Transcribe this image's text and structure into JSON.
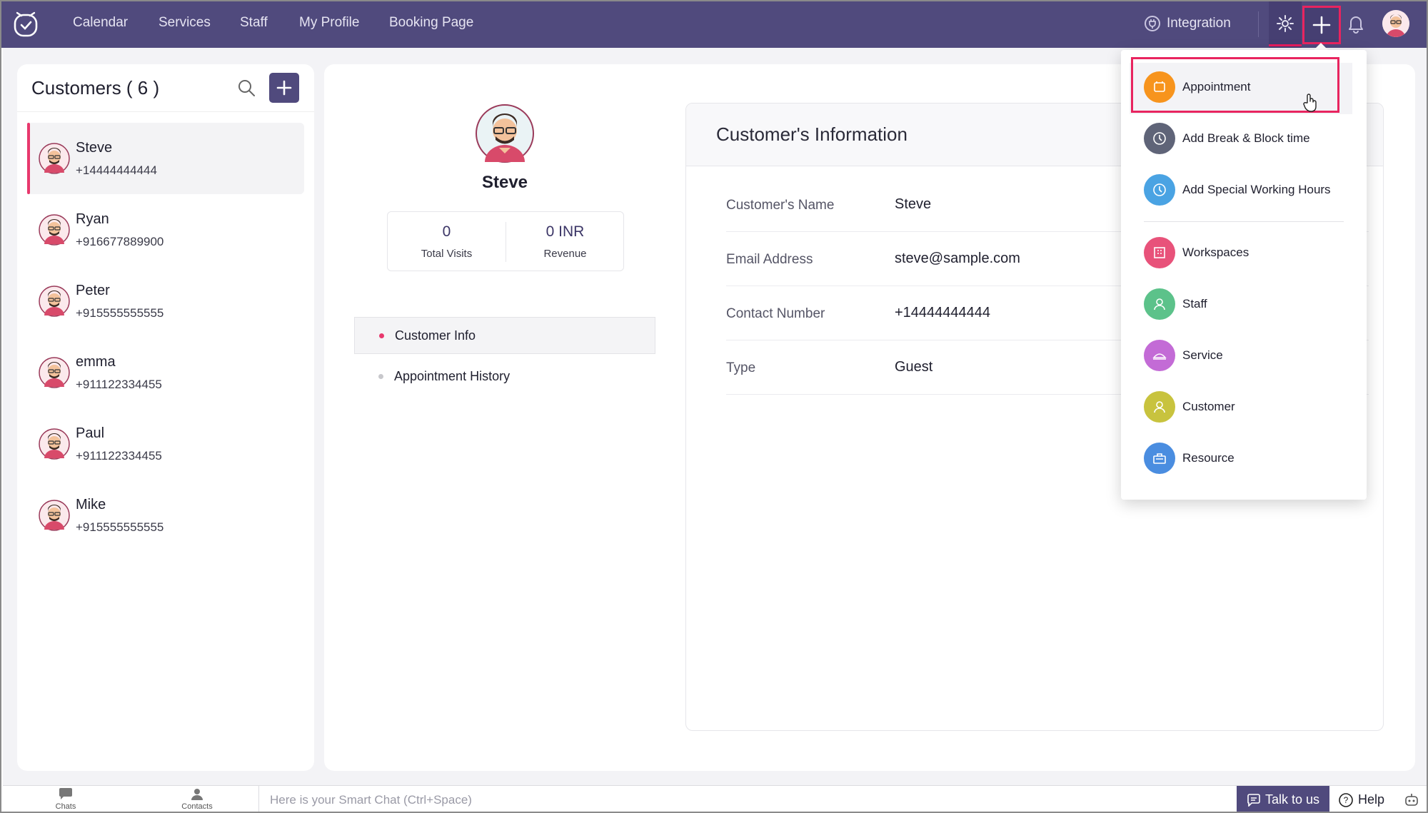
{
  "nav": {
    "items": [
      "Calendar",
      "Services",
      "Staff",
      "My Profile",
      "Booking Page"
    ],
    "integration_label": "Integration"
  },
  "customers": {
    "title": "Customers ( 6 )",
    "list": [
      {
        "name": "Steve",
        "phone": "+14444444444"
      },
      {
        "name": "Ryan",
        "phone": "+916677889900"
      },
      {
        "name": "Peter",
        "phone": "+915555555555"
      },
      {
        "name": "emma",
        "phone": "+911122334455"
      },
      {
        "name": "Paul",
        "phone": "+911122334455"
      },
      {
        "name": "Mike",
        "phone": "+915555555555"
      }
    ]
  },
  "profile": {
    "name": "Steve",
    "stats": [
      {
        "value": "0",
        "label": "Total Visits"
      },
      {
        "value": "0 INR",
        "label": "Revenue"
      }
    ],
    "tabs": [
      "Customer Info",
      "Appointment History"
    ]
  },
  "info": {
    "title": "Customer's Information",
    "rows": [
      {
        "label": "Customer's Name",
        "value": "Steve"
      },
      {
        "label": "Email Address",
        "value": "steve@sample.com"
      },
      {
        "label": "Contact Number",
        "value": "+14444444444"
      },
      {
        "label": "Type",
        "value": "Guest"
      }
    ]
  },
  "dropdown": {
    "items": [
      {
        "label": "Appointment",
        "color": "#f7941d"
      },
      {
        "label": "Add Break & Block time",
        "color": "#5f6478"
      },
      {
        "label": "Add Special Working Hours",
        "color": "#4aa3e3"
      },
      {
        "label": "Workspaces",
        "color": "#e8527a"
      },
      {
        "label": "Staff",
        "color": "#5cc28a"
      },
      {
        "label": "Service",
        "color": "#c36bd6"
      },
      {
        "label": "Customer",
        "color": "#c8c33e"
      },
      {
        "label": "Resource",
        "color": "#4a8de0"
      }
    ]
  },
  "bottom": {
    "chats_label": "Chats",
    "contacts_label": "Contacts",
    "smart_chat_placeholder": "Here is your Smart Chat (Ctrl+Space)",
    "talk_label": "Talk to us",
    "help_label": "Help"
  },
  "colors": {
    "brand": "#504a7d",
    "accent": "#e8245f"
  }
}
